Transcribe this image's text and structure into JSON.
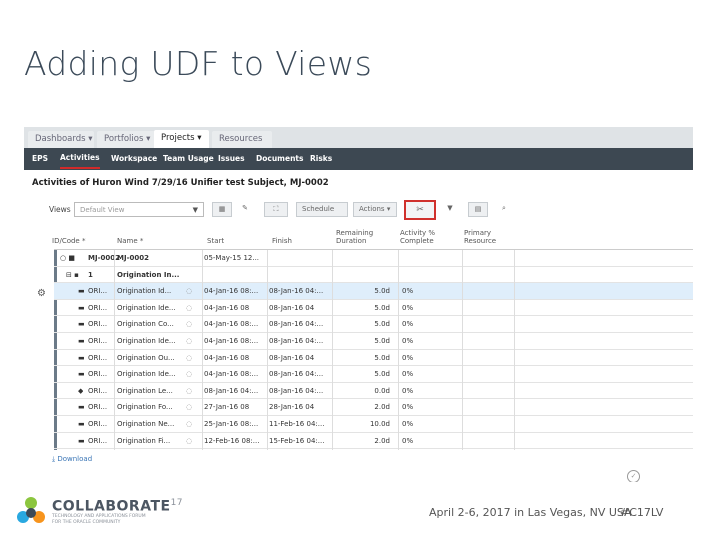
{
  "slide": {
    "title": "Adding UDF to Views",
    "footer_date": "April 2-6, 2017 in Las Vegas, NV USA",
    "footer_tag": "#C17LV",
    "logo_name": "COLLABORATE",
    "logo_year": "17",
    "logo_tagline_1": "TECHNOLOGY AND APPLICATIONS FORUM",
    "logo_tagline_2": "FOR THE ORACLE COMMUNITY"
  },
  "app": {
    "top_tabs": [
      {
        "label": "Dashboards",
        "caret": "▾"
      },
      {
        "label": "Portfolios",
        "caret": "▾"
      },
      {
        "label": "Projects",
        "caret": "▾"
      },
      {
        "label": "Resources",
        "caret": ""
      }
    ],
    "nav": [
      "EPS",
      "Activities",
      "Workspace",
      "Team Usage",
      "Issues",
      "Documents",
      "Risks"
    ],
    "page_title": "Activities of Huron Wind 7/29/16 Unifier test Subject, MJ-0002",
    "toolbar": {
      "views_label": "Views",
      "view_value": "Default View",
      "schedule_label": "Schedule",
      "actions_label": "Actions"
    },
    "columns": [
      "ID/Code *",
      "Name *",
      "Start",
      "Finish",
      "Remaining Duration",
      "Activity % Complete",
      "Primary Resource"
    ],
    "rows": [
      {
        "id": "MJ-0002",
        "name": "MJ-0002",
        "start": "05-May-15 12...",
        "finish": "",
        "dur": "",
        "pct": ""
      },
      {
        "id": "1",
        "name": "Origination In...",
        "start": "",
        "finish": "",
        "dur": "",
        "pct": ""
      },
      {
        "id": "ORI...",
        "name": "Origination Id...",
        "start": "04-Jan-16 08:...",
        "finish": "08-Jan-16 04:...",
        "dur": "5.0d",
        "pct": "0%"
      },
      {
        "id": "ORI...",
        "name": "Origination Ide...",
        "start": "04-Jan-16 08",
        "finish": "08-Jan-16 04",
        "dur": "5.0d",
        "pct": "0%"
      },
      {
        "id": "ORI...",
        "name": "Origination Co...",
        "start": "04-Jan-16 08:...",
        "finish": "08-Jan-16 04:...",
        "dur": "5.0d",
        "pct": "0%"
      },
      {
        "id": "ORI...",
        "name": "Origination Ide...",
        "start": "04-Jan-16 08:...",
        "finish": "08-Jan-16 04:...",
        "dur": "5.0d",
        "pct": "0%"
      },
      {
        "id": "ORI...",
        "name": "Origination Ou...",
        "start": "04-Jan-16 08",
        "finish": "08-Jan-16 04",
        "dur": "5.0d",
        "pct": "0%"
      },
      {
        "id": "ORI...",
        "name": "Origination Ide...",
        "start": "04-Jan-16 08:...",
        "finish": "08-Jan-16 04:...",
        "dur": "5.0d",
        "pct": "0%"
      },
      {
        "id": "ORI...",
        "name": "Origination Le...",
        "start": "08-Jan-16 04:...",
        "finish": "08-Jan-16 04:...",
        "dur": "0.0d",
        "pct": "0%"
      },
      {
        "id": "ORI...",
        "name": "Origination Fo...",
        "start": "27-Jan-16 08",
        "finish": "28-Jan-16 04",
        "dur": "2.0d",
        "pct": "0%"
      },
      {
        "id": "ORI...",
        "name": "Origination Ne...",
        "start": "25-Jan-16 08:...",
        "finish": "11-Feb-16 04:...",
        "dur": "10.0d",
        "pct": "0%"
      },
      {
        "id": "ORI...",
        "name": "Origination Fi...",
        "start": "12-Feb-16 08:...",
        "finish": "15-Feb-16 04:...",
        "dur": "2.0d",
        "pct": "0%"
      }
    ],
    "download_label": "Download"
  }
}
